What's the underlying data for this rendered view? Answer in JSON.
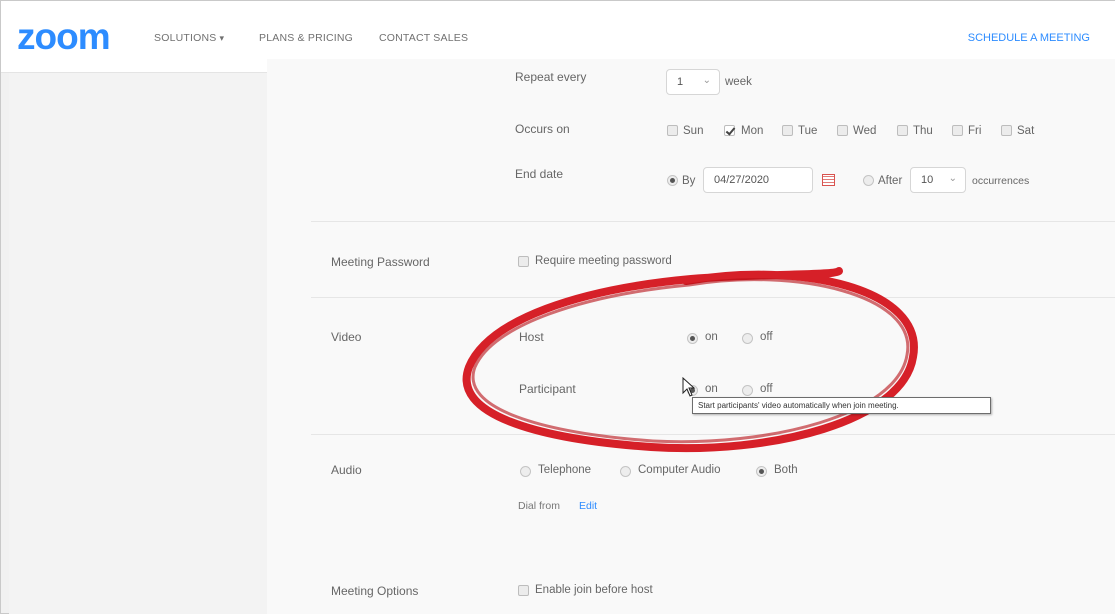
{
  "nav": {
    "logo": "zoom",
    "solutions": "SOLUTIONS",
    "plans": "PLANS & PRICING",
    "contact": "CONTACT SALES",
    "schedule": "SCHEDULE A MEETING"
  },
  "recurrence": {
    "repeat_label": "Repeat every",
    "repeat_value": "1",
    "repeat_unit": "week",
    "occurs_label": "Occurs on",
    "days": [
      {
        "label": "Sun",
        "checked": false
      },
      {
        "label": "Mon",
        "checked": true
      },
      {
        "label": "Tue",
        "checked": false
      },
      {
        "label": "Wed",
        "checked": false
      },
      {
        "label": "Thu",
        "checked": false
      },
      {
        "label": "Fri",
        "checked": false
      },
      {
        "label": "Sat",
        "checked": false
      }
    ],
    "end_label": "End date",
    "by_label": "By",
    "end_date": "04/27/2020",
    "after_label": "After",
    "occurrences_value": "10",
    "occurrences_label": "occurrences"
  },
  "password": {
    "label": "Meeting Password",
    "option": "Require meeting password"
  },
  "video": {
    "label": "Video",
    "host_label": "Host",
    "participant_label": "Participant",
    "on": "on",
    "off": "off",
    "tooltip": "Start participants' video automatically when join meeting."
  },
  "audio": {
    "label": "Audio",
    "telephone": "Telephone",
    "computer": "Computer Audio",
    "both": "Both",
    "dial_from": "Dial from",
    "edit": "Edit"
  },
  "options": {
    "label": "Meeting Options",
    "join_before_host": "Enable join before host"
  },
  "colors": {
    "brand": "#2d8cff",
    "annotation": "#d4141c"
  }
}
